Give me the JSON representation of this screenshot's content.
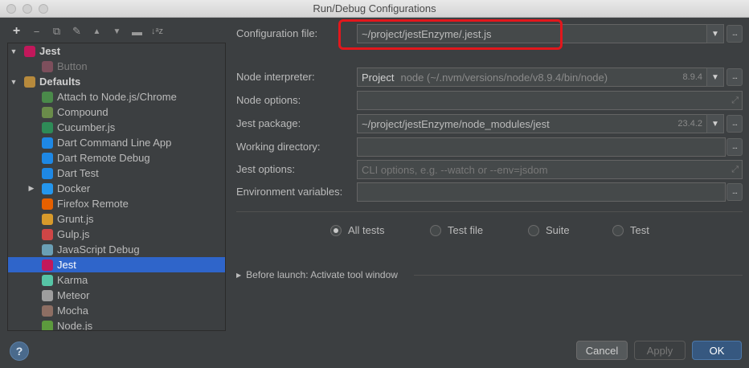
{
  "window": {
    "title": "Run/Debug Configurations"
  },
  "toolbar": {
    "add": "+",
    "remove": "−",
    "copy": "⧉",
    "edit": "✎",
    "move_up": "▲",
    "move_down": "▼",
    "folder": "▬",
    "sort": "↓ᵃz"
  },
  "tree": {
    "items": [
      {
        "label": "Jest",
        "icon": "jest-icon",
        "color": "#c2185b",
        "bold": true,
        "arrow": "▼"
      },
      {
        "label": "Button",
        "icon": "jest-icon",
        "color": "#7d4f5c",
        "dim": true
      },
      {
        "label": "Defaults",
        "icon": "wrench-icon",
        "color": "#b78a3c",
        "bold": true,
        "arrow": "▼"
      },
      {
        "label": "Attach to Node.js/Chrome",
        "icon": "attach-icon",
        "color": "#4a8a4a"
      },
      {
        "label": "Compound",
        "icon": "compound-icon",
        "color": "#6a8c4a"
      },
      {
        "label": "Cucumber.js",
        "icon": "cucumber-icon",
        "color": "#2e8b57"
      },
      {
        "label": "Dart Command Line App",
        "icon": "dart-icon",
        "color": "#1e88e5"
      },
      {
        "label": "Dart Remote Debug",
        "icon": "dart-icon",
        "color": "#1e88e5"
      },
      {
        "label": "Dart Test",
        "icon": "dart-icon",
        "color": "#1e88e5"
      },
      {
        "label": "Docker",
        "icon": "docker-icon",
        "color": "#2496ed",
        "arrow": "▶"
      },
      {
        "label": "Firefox Remote",
        "icon": "firefox-icon",
        "color": "#e66000"
      },
      {
        "label": "Grunt.js",
        "icon": "grunt-icon",
        "color": "#d89a2b"
      },
      {
        "label": "Gulp.js",
        "icon": "gulp-icon",
        "color": "#cf4646"
      },
      {
        "label": "JavaScript Debug",
        "icon": "js-debug-icon",
        "color": "#6a9fb5"
      },
      {
        "label": "Jest",
        "icon": "jest-icon",
        "color": "#c2185b",
        "selected": true
      },
      {
        "label": "Karma",
        "icon": "karma-icon",
        "color": "#56c5a6"
      },
      {
        "label": "Meteor",
        "icon": "meteor-icon",
        "color": "#9e9e9e"
      },
      {
        "label": "Mocha",
        "icon": "mocha-icon",
        "color": "#8d6e63"
      },
      {
        "label": "Node.js",
        "icon": "nodejs-icon",
        "color": "#5c9a3d"
      }
    ]
  },
  "config": {
    "config_file_label": "Configuration file:",
    "config_file_value": "~/project/jestEnzyme/.jest.js",
    "node_interpreter_label": "Node interpreter:",
    "node_interpreter_prefix": "Project",
    "node_interpreter_value": "node (~/.nvm/versions/node/v8.9.4/bin/node)",
    "node_interpreter_version": "8.9.4",
    "node_options_label": "Node options:",
    "node_options_value": "",
    "jest_package_label": "Jest package:",
    "jest_package_value": "~/project/jestEnzyme/node_modules/jest",
    "jest_package_version": "23.4.2",
    "working_dir_label": "Working directory:",
    "working_dir_value": "",
    "jest_options_label": "Jest options:",
    "jest_options_placeholder": "CLI options, e.g. --watch or --env=jsdom",
    "env_vars_label": "Environment variables:",
    "env_vars_value": "",
    "ellipsis": "...",
    "dropdown_arrow": "▼",
    "expand_glyph": "⤢"
  },
  "scope": {
    "options": [
      "All tests",
      "Test file",
      "Suite",
      "Test"
    ],
    "selected": "All tests"
  },
  "before_launch": {
    "arrow": "▶",
    "label": "Before launch: Activate tool window"
  },
  "buttons": {
    "help": "?",
    "cancel": "Cancel",
    "apply": "Apply",
    "ok": "OK"
  }
}
